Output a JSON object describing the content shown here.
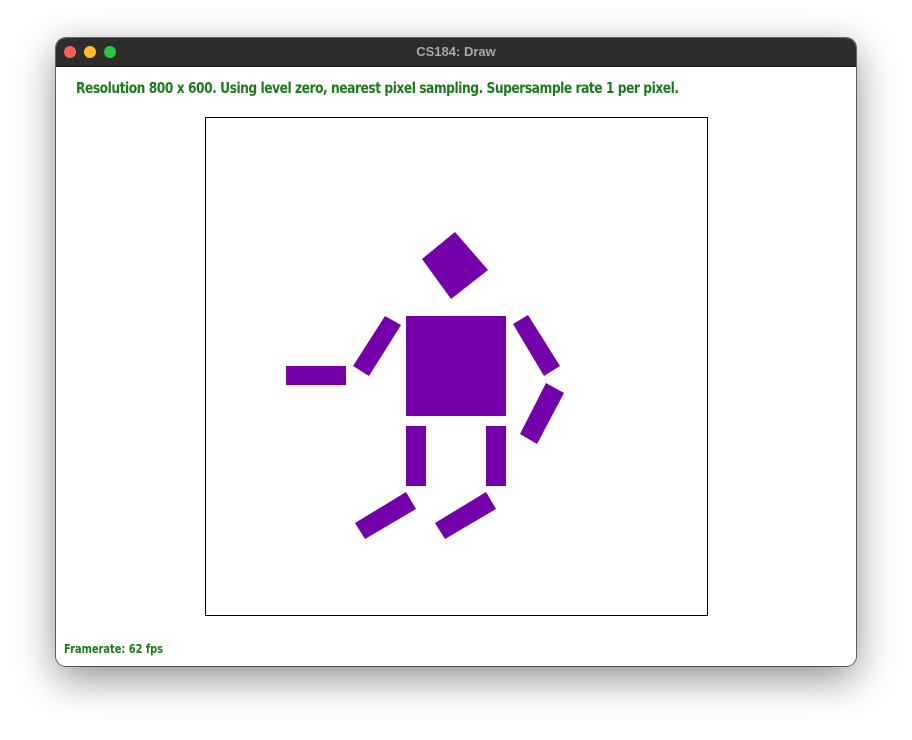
{
  "window": {
    "title": "CS184: Draw"
  },
  "overlay": {
    "status": "Resolution 800 x 600. Using level zero, nearest pixel sampling. Supersample rate 1 per pixel.",
    "framerate": "Framerate: 62 fps"
  },
  "colors": {
    "shape_fill": "#7300aa",
    "overlay_text": "#1d7a1d",
    "titlebar": "#2d2d2d"
  }
}
